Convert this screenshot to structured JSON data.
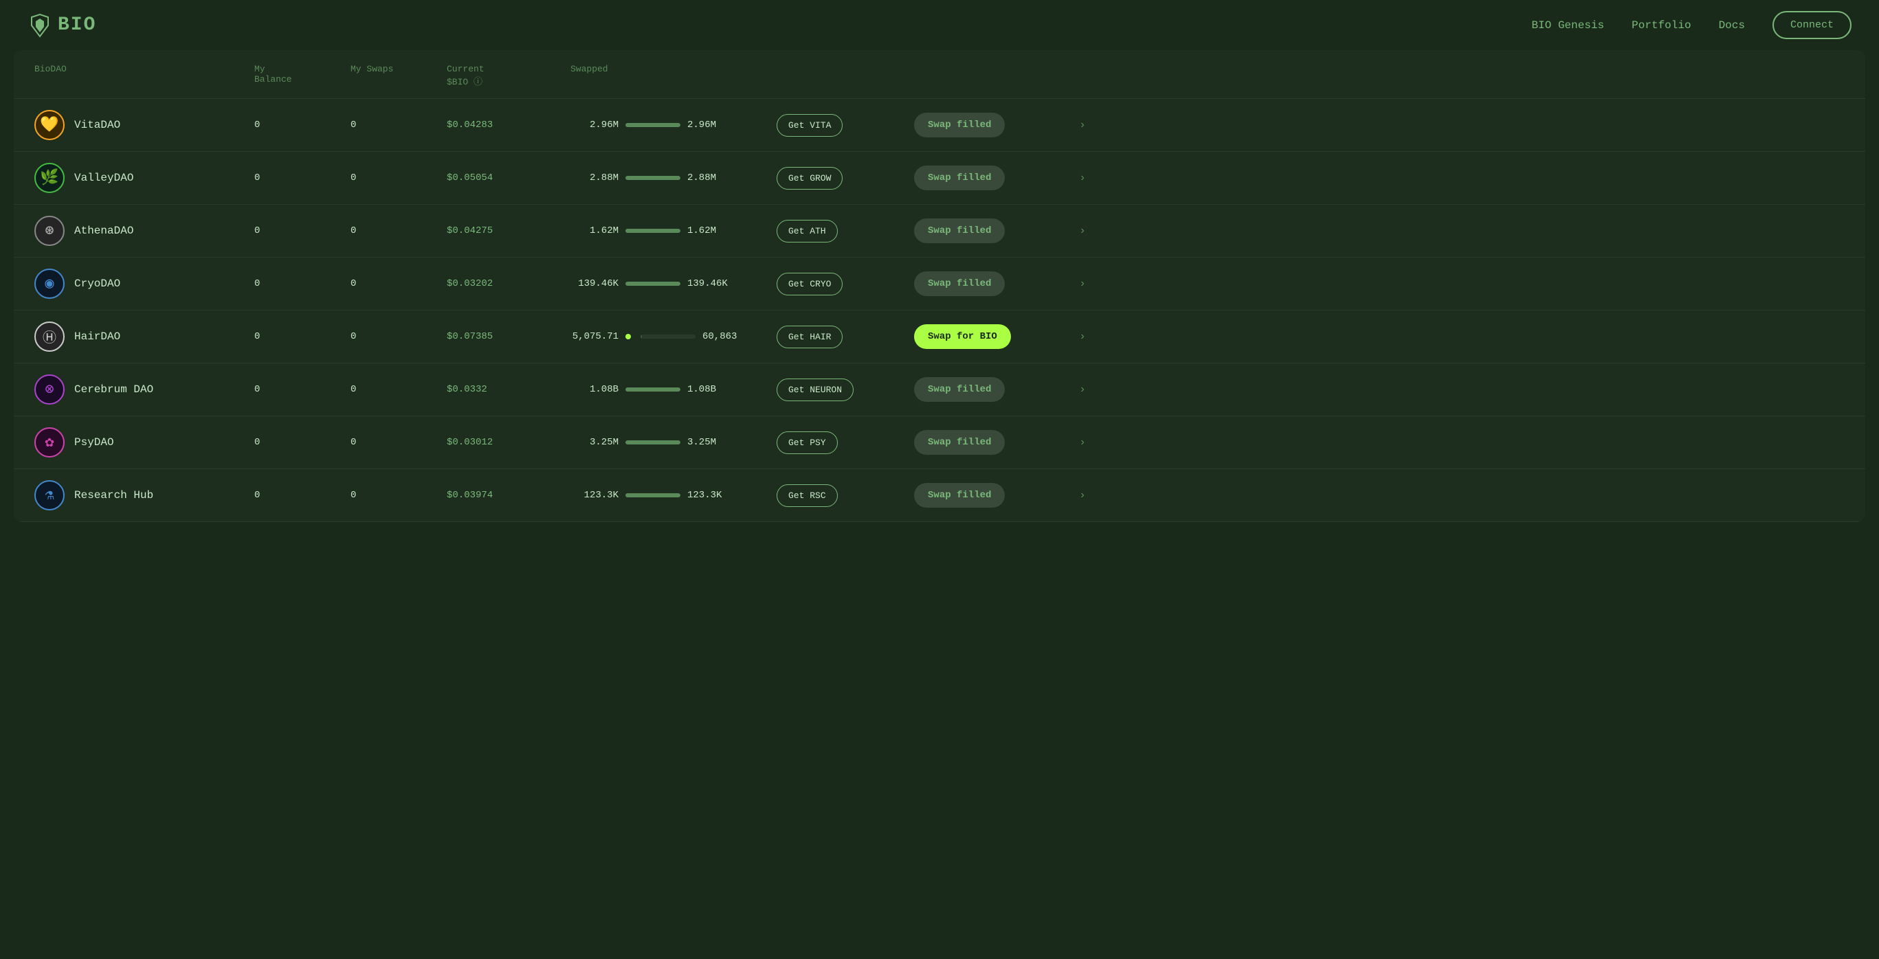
{
  "app": {
    "title": "BIO",
    "logo_symbol": "✕"
  },
  "nav": {
    "items": [
      {
        "label": "BIO Genesis",
        "key": "bio-genesis"
      },
      {
        "label": "Portfolio",
        "key": "portfolio"
      },
      {
        "label": "Docs",
        "key": "docs"
      }
    ],
    "connect_label": "Connect"
  },
  "table": {
    "columns": {
      "biodao": "BioDAO",
      "my_balance": "My\nBalance",
      "my_swaps": "My Swaps",
      "current_bio": "Current\n$BIO ⓘ",
      "swapped": "Swapped"
    },
    "rows": [
      {
        "key": "vitadao",
        "name": "VitaDAO",
        "logo_bg": "#2a1a00",
        "logo_color": "#f5a623",
        "logo_char": "♥",
        "logo_emoji": "💛",
        "balance": "0",
        "swaps": "0",
        "price": "$0.04283",
        "amount_left": "2.96M",
        "amount_right": "2.96M",
        "progress": 100,
        "get_label": "Get VITA",
        "swap_label": "Swap filled",
        "swap_type": "filled"
      },
      {
        "key": "valleydao",
        "name": "ValleyDAO",
        "logo_bg": "#0a2a1a",
        "logo_color": "#44aa44",
        "logo_char": "✦",
        "logo_emoji": "🌿",
        "balance": "0",
        "swaps": "0",
        "price": "$0.05054",
        "amount_left": "2.88M",
        "amount_right": "2.88M",
        "progress": 100,
        "get_label": "Get GROW",
        "swap_label": "Swap filled",
        "swap_type": "filled"
      },
      {
        "key": "athenadao",
        "name": "AthenaDAO",
        "logo_bg": "#2a2a2a",
        "logo_color": "#aaaaaa",
        "logo_char": "⊛",
        "logo_emoji": "🔮",
        "balance": "0",
        "swaps": "0",
        "price": "$0.04275",
        "amount_left": "1.62M",
        "amount_right": "1.62M",
        "progress": 100,
        "get_label": "Get ATH",
        "swap_label": "Swap filled",
        "swap_type": "filled"
      },
      {
        "key": "cryodao",
        "name": "CryoDAO",
        "logo_bg": "#0a1a2a",
        "logo_color": "#4488cc",
        "logo_char": "◉",
        "logo_emoji": "❄️",
        "balance": "0",
        "swaps": "0",
        "price": "$0.03202",
        "amount_left": "139.46K",
        "amount_right": "139.46K",
        "progress": 100,
        "get_label": "Get CRYO",
        "swap_label": "Swap filled",
        "swap_type": "filled"
      },
      {
        "key": "hairdao",
        "name": "HairDAO",
        "logo_bg": "#2a2a2a",
        "logo_color": "#cccccc",
        "logo_char": "Ⓗ",
        "logo_emoji": "💇",
        "balance": "0",
        "swaps": "0",
        "price": "$0.07385",
        "amount_left": "5,075.71",
        "amount_right": "60,863",
        "progress": 2,
        "get_label": "Get HAIR",
        "swap_label": "Swap for BIO",
        "swap_type": "active"
      },
      {
        "key": "cerebrumdao",
        "name": "Cerebrum DAO",
        "logo_bg": "#1a0a2a",
        "logo_color": "#aa44cc",
        "logo_char": "⊗",
        "logo_emoji": "🧠",
        "balance": "0",
        "swaps": "0",
        "price": "$0.0332",
        "amount_left": "1.08B",
        "amount_right": "1.08B",
        "progress": 100,
        "get_label": "Get NEURON",
        "swap_label": "Swap filled",
        "swap_type": "filled"
      },
      {
        "key": "psydao",
        "name": "PsyDAO",
        "logo_bg": "#2a0a2a",
        "logo_color": "#cc44aa",
        "logo_char": "✿",
        "logo_emoji": "🌀",
        "balance": "0",
        "swaps": "0",
        "price": "$0.03012",
        "amount_left": "3.25M",
        "amount_right": "3.25M",
        "progress": 100,
        "get_label": "Get PSY",
        "swap_label": "Swap filled",
        "swap_type": "filled"
      },
      {
        "key": "researchhub",
        "name": "Research Hub",
        "logo_bg": "#0a1a2a",
        "logo_color": "#4488cc",
        "logo_char": "⚗",
        "logo_emoji": "🔬",
        "balance": "0",
        "swaps": "0",
        "price": "$0.03974",
        "amount_left": "123.3K",
        "amount_right": "123.3K",
        "progress": 100,
        "get_label": "Get RSC",
        "swap_label": "Swap filled",
        "swap_type": "filled"
      }
    ]
  },
  "icons": {
    "chevron_down": "›",
    "info": "ⓘ"
  }
}
